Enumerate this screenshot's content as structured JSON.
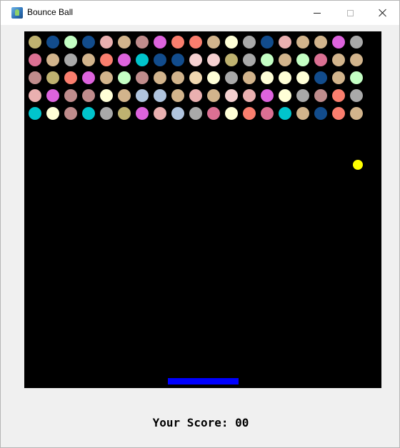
{
  "window": {
    "title": "Bounce Ball"
  },
  "game": {
    "background_color": "#000000",
    "brick_rows": [
      [
        "#bfb270",
        "#124c8c",
        "#c4ffc4",
        "#124c8c",
        "#eab0b0",
        "#d2b48c",
        "#c08c8c",
        "#dd63dd",
        "#fa7e6e",
        "#fa7e6e",
        "#d2b48c",
        "#ffffd7",
        "#a9a9a9",
        "#124c8c",
        "#eab0b0",
        "#d2b48c",
        "#d2b48c",
        "#dd63dd",
        "#a9a9a9"
      ],
      [
        "#db7093",
        "#d2b48c",
        "#a9a9a9",
        "#d2b48c",
        "#fa7e6e",
        "#dd63dd",
        "#00c4cc",
        "#124c8c",
        "#124c8c",
        "#f5d0d0",
        "#f5d0d0",
        "#bfb270",
        "#a9a9a9",
        "#c4ffc4",
        "#d2b48c",
        "#c4ffc4",
        "#db7093",
        "#d2b48c",
        "#d2b48c"
      ],
      [
        "#c08c8c",
        "#bfb270",
        "#fa7e6e",
        "#dd63dd",
        "#d2b48c",
        "#c4ffc4",
        "#c08c8c",
        "#d2b48c",
        "#d2b48c",
        "#f0d8b0",
        "#ffffd7",
        "#a9a9a9",
        "#d2b48c",
        "#ffffd7",
        "#ffffd7",
        "#ffffd7",
        "#124c8c",
        "#d2b48c",
        "#c4ffc4"
      ],
      [
        "#eab0b0",
        "#dd63dd",
        "#c08c8c",
        "#c08c8c",
        "#ffffd7",
        "#d2b48c",
        "#b0c4de",
        "#b0c4de",
        "#d2b48c",
        "#eab0b0",
        "#d2b48c",
        "#f5d0d0",
        "#eab0b0",
        "#dd63dd",
        "#ffffd7",
        "#a9a9a9",
        "#c08c8c",
        "#fa7e6e",
        "#a9a9a9"
      ],
      [
        "#00c4cc",
        "#ffffd7",
        "#c08c8c",
        "#00c4cc",
        "#a9a9a9",
        "#bfb270",
        "#dd63dd",
        "#eab0b0",
        "#b0c4de",
        "#a9a9a9",
        "#db7093",
        "#ffffd7",
        "#fa7e6e",
        "#db7093",
        "#00c4cc",
        "#d2b48c",
        "#124c8c",
        "#fa7e6e",
        "#d2b48c"
      ]
    ],
    "ball": {
      "color": "#ffff00"
    },
    "paddle": {
      "color": "#0000ff"
    }
  },
  "score": {
    "label": "Your Score:",
    "value": "00"
  }
}
